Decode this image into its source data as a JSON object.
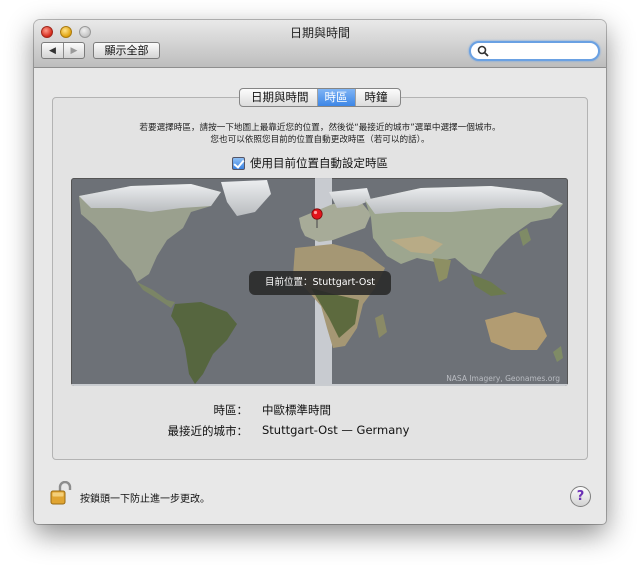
{
  "window": {
    "title": "日期與時間",
    "show_all": "顯示全部",
    "nav_back": "◀",
    "nav_forward": "▶",
    "search_placeholder": ""
  },
  "tabs": [
    {
      "label": "日期與時間",
      "active": false
    },
    {
      "label": "時區",
      "active": true
    },
    {
      "label": "時鐘",
      "active": false
    }
  ],
  "instructions": {
    "line1": "若要選擇時區，請按一下地圖上最靠近您的位置，然後從“最接近的城市”選單中選擇一個城市。",
    "line2": "您也可以依照您目前的位置自動更改時區（若可以的話）。"
  },
  "auto_timezone": {
    "label": "使用目前位置自動設定時區",
    "checked": true
  },
  "map": {
    "tooltip": "目前位置：Stuttgart-Ost",
    "credit": "NASA Imagery, Geonames.org",
    "colors": {
      "ocean": "#6d7177",
      "land_highlight": "#dfe1e4",
      "timezone_band": "#d8dadf",
      "pin": "#e2141a"
    }
  },
  "info": {
    "timezone_label": "時區：",
    "timezone_value": "中歐標準時間",
    "city_label": "最接近的城市：",
    "city_value": "Stuttgart-Ost — Germany"
  },
  "footer": {
    "lock_text": "按鎖頭一下防止進一步更改。",
    "help": "?"
  }
}
